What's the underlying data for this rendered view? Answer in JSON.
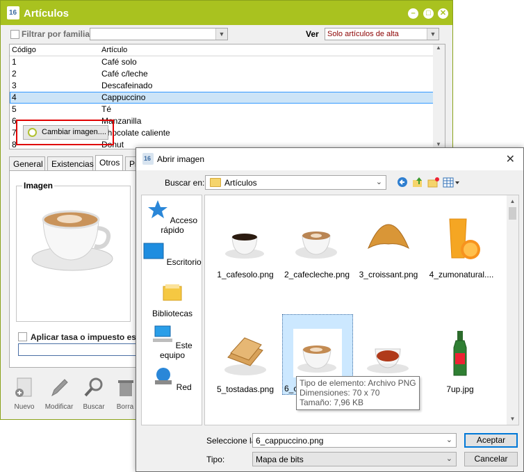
{
  "main_window": {
    "title": "Artículos",
    "filter_label": "Filtrar por familia",
    "filter_value": "",
    "view_label": "Ver",
    "view_value": "Solo artículos de alta",
    "grid": {
      "columns": [
        "Código",
        "Artículo"
      ],
      "rows": [
        {
          "code": "1",
          "name": "Café solo"
        },
        {
          "code": "2",
          "name": "Café c/leche"
        },
        {
          "code": "3",
          "name": "Descafeinado"
        },
        {
          "code": "4",
          "name": "Cappuccino"
        },
        {
          "code": "5",
          "name": "Té"
        },
        {
          "code": "6",
          "name": "Manzanilla"
        },
        {
          "code": "7",
          "name": "Chocolate caliente"
        },
        {
          "code": "8",
          "name": "Donut"
        }
      ],
      "selected_code": "4"
    },
    "tabs": [
      "General",
      "Existencias",
      "Otros",
      "Pr"
    ],
    "active_tab": "Otros",
    "image_group_label": "Imagen",
    "change_image_button": "Cambiar imagen....",
    "tax_label": "Aplicar tasa o impuesto esp",
    "toolbar": [
      "Nuevo",
      "Modificar",
      "Buscar",
      "Borra"
    ]
  },
  "dialog": {
    "title": "Abrir imagen",
    "look_in_label": "Buscar en:",
    "look_in_value": "Artículos",
    "places": [
      "Acceso rápido",
      "Escritorio",
      "Bibliotecas",
      "Este equipo",
      "Red"
    ],
    "files": [
      {
        "name": "1_cafesolo.png",
        "icon": "espresso-cup"
      },
      {
        "name": "2_cafecleche.png",
        "icon": "latte-cup"
      },
      {
        "name": "3_croissant.png",
        "icon": "croissant"
      },
      {
        "name": "4_zumonatural....",
        "icon": "orange-juice"
      },
      {
        "name": "5_tostadas.png",
        "icon": "toast"
      },
      {
        "name": "6_c",
        "icon": "cappuccino-cup"
      },
      {
        "name": "",
        "icon": "tea-cup"
      },
      {
        "name": "7up.jpg",
        "icon": "bottle"
      }
    ],
    "selected_file_index": 5,
    "tooltip": {
      "type": "Tipo de elemento: Archivo PNG",
      "dimensions": "Dimensiones: 70 x 70",
      "size": "Tamaño: 7,96 KB"
    },
    "filename_label": "Seleccione la",
    "filename_value": "6_cappuccino.png",
    "type_label": "Tipo:",
    "type_value": "Mapa de bits",
    "accept_button": "Aceptar",
    "cancel_button": "Cancelar"
  },
  "colors": {
    "title_bar": "#a9c21f",
    "selection": "#cce4f7",
    "highlight_box": "#e00000",
    "view_text": "#8b0000"
  }
}
